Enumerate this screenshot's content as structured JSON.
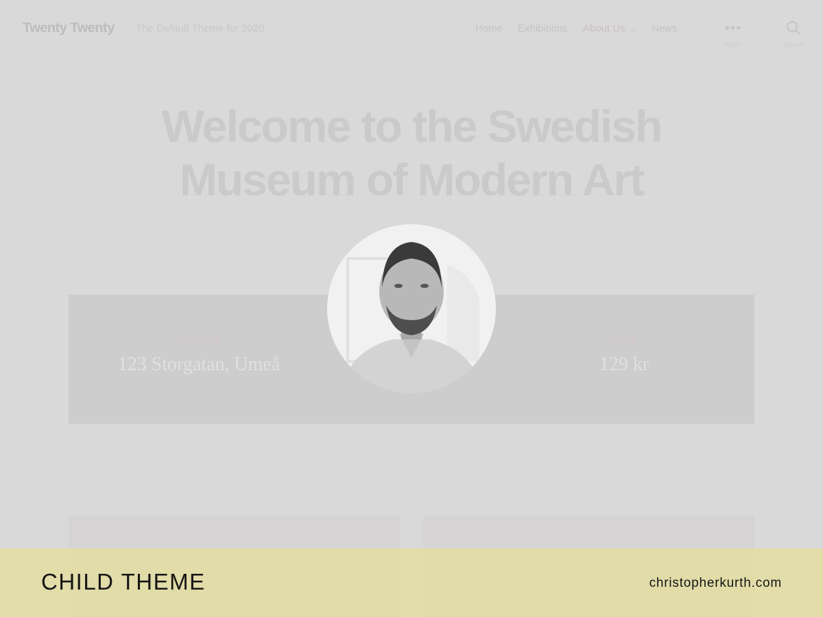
{
  "header": {
    "site_title": "Twenty Twenty",
    "tagline": "The Default Theme for 2020",
    "nav": [
      {
        "label": "Home"
      },
      {
        "label": "Exhibitions"
      },
      {
        "label": "About Us"
      },
      {
        "label": "News"
      }
    ],
    "menu_label": "Menu",
    "search_label": "Search"
  },
  "hero": {
    "title_line1": "Welcome to the Swedish",
    "title_line2": "Museum of Modern Art"
  },
  "info": {
    "address_label": "ADDRESS",
    "address_value": "123 Storgatan, Umeå",
    "price_label": "PRICE",
    "price_value": "129 kr"
  },
  "footer": {
    "left_text": "CHILD THEME",
    "right_text": "christopherkurth.com"
  },
  "colors": {
    "overlay_bg": "#d9d9d9",
    "footer_band": "#e3dda2"
  }
}
